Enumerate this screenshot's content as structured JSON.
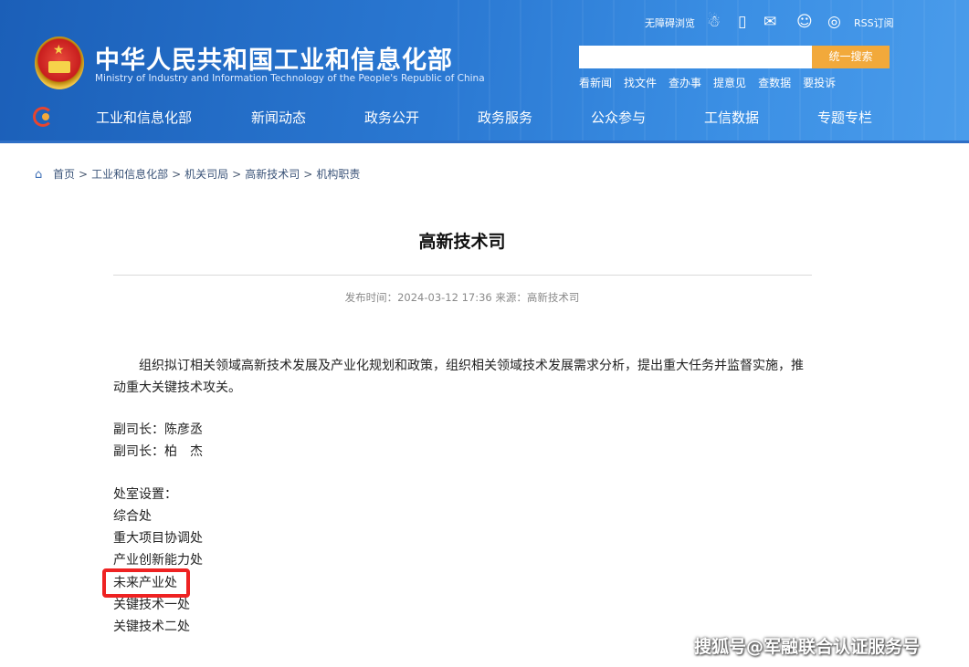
{
  "header": {
    "ministry_cn": "中华人民共和国工业和信息化部",
    "ministry_en": "Ministry of Industry and Information Technology of the People's Republic of China",
    "accessibility": "无障碍浏览",
    "rss": "RSS订阅",
    "search_placeholder": "",
    "search_button": "统一搜索",
    "quick_links": [
      "看新闻",
      "找文件",
      "查办事",
      "提意见",
      "查数据",
      "要投诉"
    ],
    "nav": [
      "工业和信息化部",
      "新闻动态",
      "政务公开",
      "政务服务",
      "公众参与",
      "工信数据",
      "专题专栏"
    ],
    "accent_color": "#f2a93b",
    "header_color": "#2a78d2"
  },
  "breadcrumb": [
    "首页",
    "工业和信息化部",
    "机关司局",
    "高新技术司",
    "机构职责"
  ],
  "article": {
    "title": "高新技术司",
    "meta": "发布时间：2024-03-12 17:36  来源：高新技术司",
    "paragraph": "组织拟订相关领域高新技术发展及产业化规划和政策，组织相关领域技术发展需求分析，提出重大任务并监督实施，推动重大关键技术攻关。",
    "leaders": [
      "副司长：陈彦丞",
      "副司长：柏　杰"
    ],
    "divisions_heading": "处室设置：",
    "divisions": [
      "综合处",
      "重大项目协调处",
      "产业创新能力处",
      "未来产业处",
      "关键技术一处",
      "关键技术二处"
    ],
    "highlighted_division": "未来产业处",
    "highlight_color": "#ee2222"
  },
  "watermark": "搜狐号@军融联合认证服务号"
}
